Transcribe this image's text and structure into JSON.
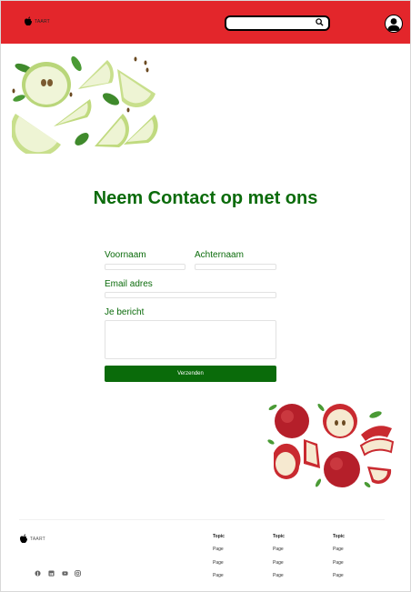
{
  "header": {
    "logo_text": "TAART"
  },
  "title": "Neem Contact op met ons",
  "form": {
    "first_name_label": "Voornaam",
    "last_name_label": "Achternaam",
    "email_label": "Email adres",
    "message_label": "Je bericht",
    "submit_label": "Verzenden"
  },
  "footer": {
    "logo_text": "TAART",
    "social_icons": [
      "facebook-icon",
      "linkedin-icon",
      "youtube-icon",
      "instagram-icon"
    ],
    "columns": [
      {
        "title": "Topic",
        "links": [
          "Page",
          "Page",
          "Page"
        ]
      },
      {
        "title": "Topic",
        "links": [
          "Page",
          "Page",
          "Page"
        ]
      },
      {
        "title": "Topic",
        "links": [
          "Page",
          "Page",
          "Page"
        ]
      }
    ]
  },
  "colors": {
    "header": "#e3262b",
    "accent_green": "#0b6b0b"
  }
}
